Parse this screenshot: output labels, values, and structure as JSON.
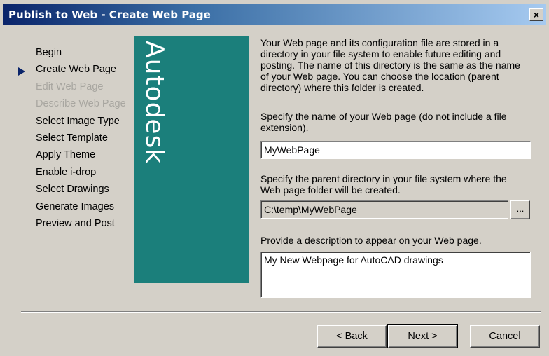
{
  "window": {
    "title": "Publish to Web - Create Web Page",
    "close_label": "×"
  },
  "steps": [
    {
      "label": "Begin",
      "state": "normal"
    },
    {
      "label": "Create Web Page",
      "state": "current"
    },
    {
      "label": "Edit Web Page",
      "state": "disabled"
    },
    {
      "label": "Describe Web Page",
      "state": "disabled"
    },
    {
      "label": "Select Image Type",
      "state": "normal"
    },
    {
      "label": "Select Template",
      "state": "normal"
    },
    {
      "label": "Apply Theme",
      "state": "normal"
    },
    {
      "label": "Enable i-drop",
      "state": "normal"
    },
    {
      "label": "Select Drawings",
      "state": "normal"
    },
    {
      "label": "Generate Images",
      "state": "normal"
    },
    {
      "label": "Preview and Post",
      "state": "normal"
    }
  ],
  "brand": {
    "logo_text": "Autodesk",
    "panel_color": "#1b7f7b"
  },
  "main": {
    "intro_lines": [
      "Your Web page and its configuration file are stored in a",
      "directory in your file system to enable future editing and",
      "posting.  The name of this directory is the same as the name",
      "of your Web page.  You can choose the location (parent",
      "directory) where this folder is created."
    ],
    "name_prompt_lines": [
      "Specify the name of your Web page (do not include a file",
      "extension)."
    ],
    "name_value": "MyWebPage",
    "dir_prompt_lines": [
      "Specify the parent directory in your file system where the",
      "Web page folder will be created."
    ],
    "dir_value": "C:\\temp\\MyWebPage",
    "browse_label": "...",
    "desc_prompt": "Provide a description to appear on your Web page.",
    "desc_value": "My New Webpage for AutoCAD drawings"
  },
  "buttons": {
    "back": "< Back",
    "next": "Next >",
    "cancel": "Cancel"
  }
}
